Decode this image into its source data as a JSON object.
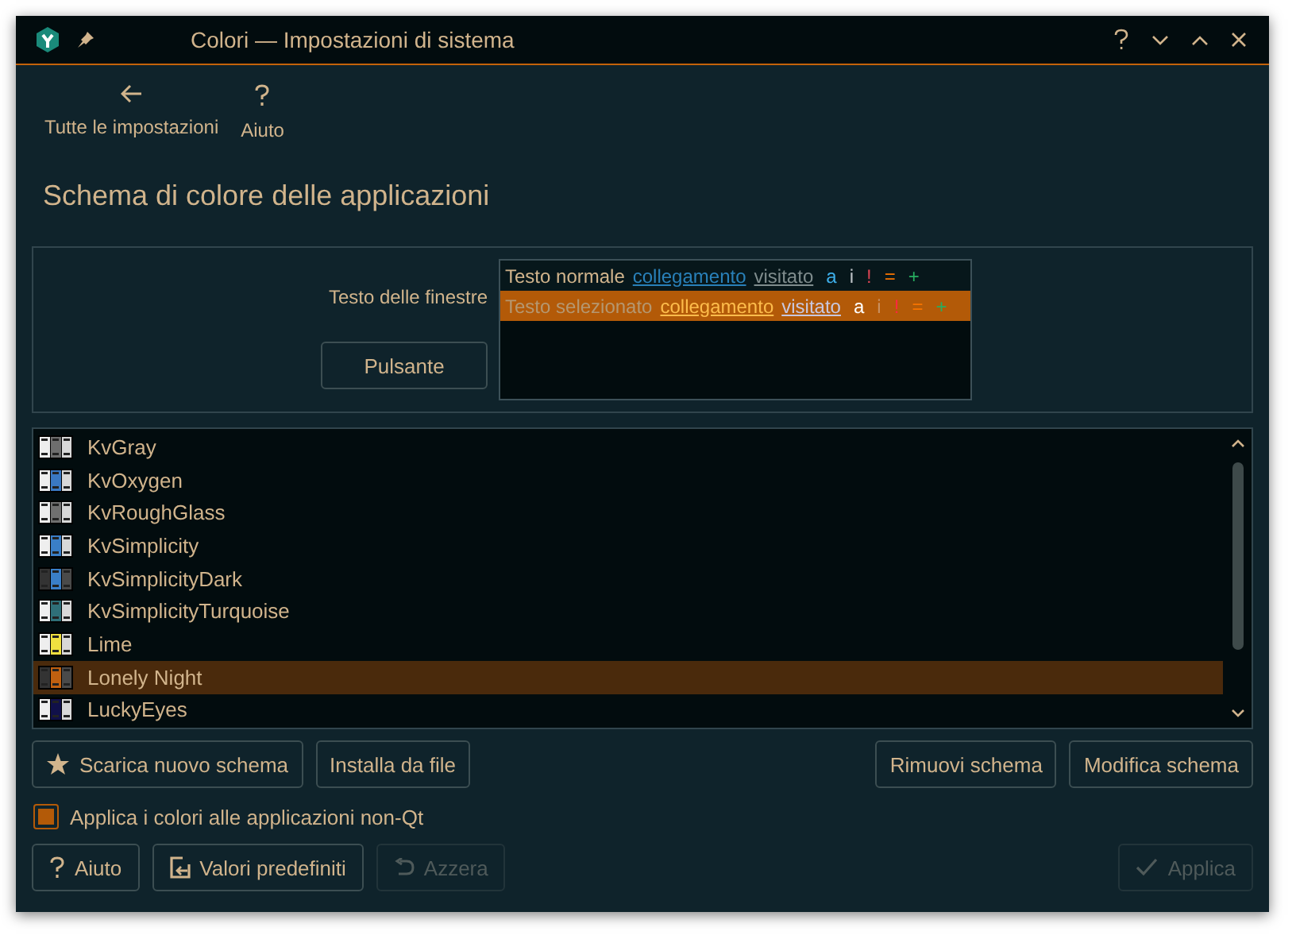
{
  "window": {
    "title": "Colori — Impostazioni di sistema"
  },
  "toolbar": [
    {
      "kind": "back",
      "label": "Tutte le impostazioni"
    },
    {
      "kind": "help",
      "label": "Aiuto"
    }
  ],
  "heading": "Schema di colore delle applicazioni",
  "preview": {
    "window_text_label": "Testo delle finestre",
    "button": "Pulsante",
    "rows": [
      {
        "selected": false,
        "items": [
          {
            "text": "Testo normale",
            "kind": "plain",
            "color": "#d1b48c"
          },
          {
            "text": "collegamento",
            "kind": "link",
            "color": "#2980b9"
          },
          {
            "text": "visitato",
            "kind": "link",
            "color": "#7f8c8d"
          },
          {
            "text": "a",
            "kind": "plain",
            "color": "#3daee9"
          },
          {
            "text": "i",
            "kind": "plain",
            "color": "#bdc3c7"
          },
          {
            "text": "!",
            "kind": "plain",
            "color": "#da4453"
          },
          {
            "text": "=",
            "kind": "plain",
            "color": "#f67400"
          },
          {
            "text": "+",
            "kind": "plain",
            "color": "#27ae60"
          }
        ]
      },
      {
        "selected": true,
        "items": [
          {
            "text": "Testo selezionato",
            "kind": "plain",
            "color": "#b59770"
          },
          {
            "text": "collegamento",
            "kind": "link",
            "color": "#fdbc4b"
          },
          {
            "text": "visitato",
            "kind": "link",
            "color": "#c8c8e0"
          },
          {
            "text": "a",
            "kind": "plain",
            "color": "#ffffff"
          },
          {
            "text": "i",
            "kind": "plain",
            "color": "#c89060"
          },
          {
            "text": "!",
            "kind": "plain",
            "color": "#ff2840"
          },
          {
            "text": "=",
            "kind": "plain",
            "color": "#f67400"
          },
          {
            "text": "+",
            "kind": "plain",
            "color": "#27ae60"
          }
        ]
      }
    ]
  },
  "schemes": [
    {
      "name": "KvGray",
      "selected": false,
      "kind": "light",
      "color": "#6e6e6e"
    },
    {
      "name": "KvOxygen",
      "selected": false,
      "kind": "light",
      "color": "#3a78c2"
    },
    {
      "name": "KvRoughGlass",
      "selected": false,
      "kind": "light",
      "color": "#707070"
    },
    {
      "name": "KvSimplicity",
      "selected": false,
      "kind": "light",
      "color": "#3a7fc8"
    },
    {
      "name": "KvSimplicityDark",
      "selected": false,
      "kind": "dark",
      "color": "#3a7fc8"
    },
    {
      "name": "KvSimplicityTurquoise",
      "selected": false,
      "kind": "light",
      "color": "#2f6f78"
    },
    {
      "name": "Lime",
      "selected": false,
      "kind": "light",
      "color": "#f0e040"
    },
    {
      "name": "Lonely Night",
      "selected": true,
      "kind": "dark",
      "color": "#c06010"
    },
    {
      "name": "LuckyEyes",
      "selected": false,
      "kind": "light",
      "color": "#10104a"
    }
  ],
  "list_buttons_left": [
    {
      "kind": "star",
      "label": "Scarica nuovo schema",
      "disabled": false
    },
    {
      "kind": "plain",
      "label": "Installa da file",
      "disabled": false
    }
  ],
  "list_buttons_right": [
    {
      "label": "Rimuovi schema",
      "disabled": false
    },
    {
      "label": "Modifica schema",
      "disabled": false
    }
  ],
  "apply_non_qt": {
    "label": "Applica i colori alle applicazioni non-Qt",
    "checked": true
  },
  "footer_left": [
    {
      "kind": "help",
      "label": "Aiuto",
      "disabled": false
    },
    {
      "kind": "defaults",
      "label": "Valori predefiniti",
      "disabled": false
    },
    {
      "kind": "reset",
      "label": "Azzera",
      "disabled": true
    }
  ],
  "footer_right": [
    {
      "kind": "apply",
      "label": "Applica",
      "disabled": true
    }
  ]
}
